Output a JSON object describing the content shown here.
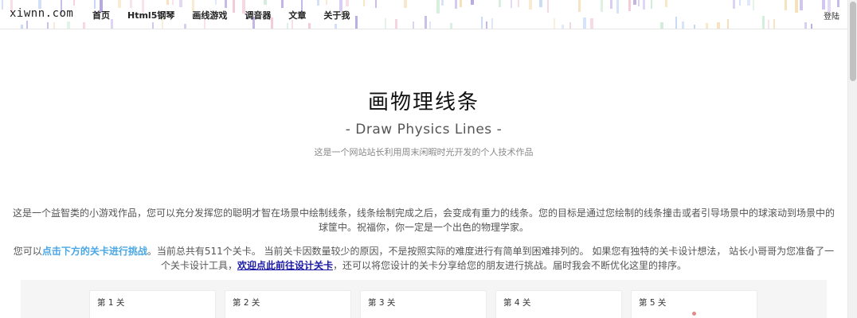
{
  "header": {
    "logo": "xiwnn.com",
    "nav": [
      "首页",
      "Html5钢琴",
      "画线游戏",
      "调音器",
      "文章",
      "关于我"
    ],
    "login": "登陆"
  },
  "hero": {
    "title": "画物理线条",
    "subtitle": "- Draw Physics Lines -",
    "desc": "这是一个网站站长利用周末闲暇时光开发的个人技术作品"
  },
  "intro": {
    "p1": "这是一个益智类的小游戏作品，您可以充分发挥您的聪明才智在场景中绘制线条，线条绘制完成之后，会变成有重力的线条。您的目标是通过您绘制的线条撞击或者引导场景中的球滚动到场景中的球筐中。祝福你，你一定是一个出色的物理学家。",
    "p2_a": "您可以",
    "p2_link1": "点击下方的关卡进行挑战",
    "p2_b": "。当前总共有511个关卡。 当前关卡因数量较少的原因，不是按照实际的难度进行有简单到困难排列的。 如果您有独特的关卡设计想法， 站长小哥哥为您准备了一个关卡设计工具，",
    "p2_link2": "欢迎点此前往设计关卡",
    "p2_c": "，还可以将您设计的关卡分享给您的朋友进行挑战。届时我会不断优化这里的排序。"
  },
  "levels": [
    "第 1 关",
    "第 2 关",
    "第 3 关",
    "第 4 关",
    "第 5 关"
  ],
  "colors": {
    "link": "#4aa7e6",
    "link_visited": "#1a1aa6",
    "stripe_palette": [
      "#b9a6e8",
      "#a7c4f0",
      "#f0b6c8",
      "#b7e3c6",
      "#f3d6a2",
      "#9a86d6"
    ]
  }
}
